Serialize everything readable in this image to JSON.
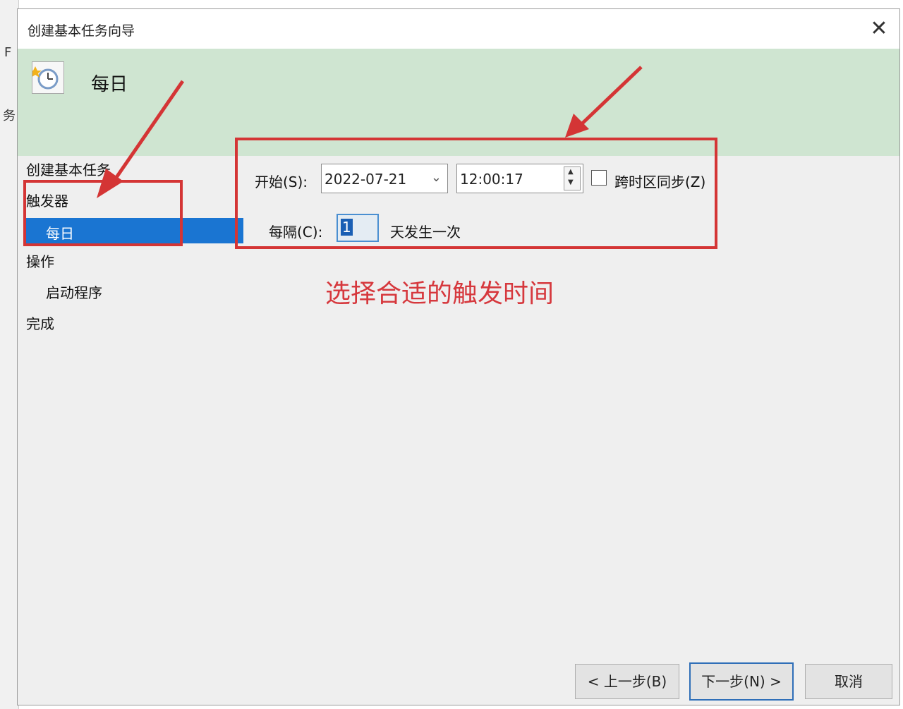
{
  "background_window": {
    "edge_glyphs": [
      "F",
      "务"
    ]
  },
  "dialog": {
    "title": "创建基本任务向导",
    "close_icon": "close-icon"
  },
  "header": {
    "icon": "clock-task-icon",
    "title": "每日",
    "background_color": "#cfe5d1"
  },
  "nav": {
    "items": [
      {
        "label": "创建基本任务",
        "level": 0
      },
      {
        "label": "触发器",
        "level": 0
      },
      {
        "label": "每日",
        "level": 1,
        "selected": true
      },
      {
        "label": "操作",
        "level": 0
      },
      {
        "label": "启动程序",
        "level": 1
      },
      {
        "label": "完成",
        "level": 0
      }
    ],
    "selected_color": "#1a75d2"
  },
  "form": {
    "start_label": "开始(S):",
    "start_date": "2022-07-21",
    "start_time": "12:00:17",
    "sync_label": "跨时区同步(Z)",
    "sync_checked": false,
    "interval_label": "每隔(C):",
    "interval_value": "1",
    "interval_suffix": "天发生一次"
  },
  "annotation": {
    "hint": "选择合适的触发时间",
    "color": "#d43535"
  },
  "buttons": {
    "back": "< 上一步(B)",
    "next": "下一步(N) >",
    "cancel": "取消"
  }
}
